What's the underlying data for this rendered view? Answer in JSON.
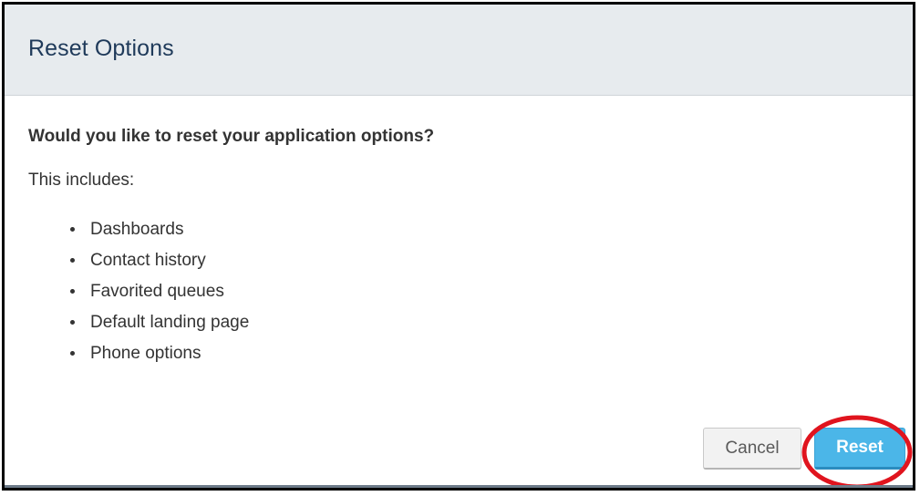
{
  "dialog": {
    "title": "Reset Options",
    "question": "Would you like to reset your application options?",
    "includes_label": "This includes:",
    "items": [
      {
        "label": "Dashboards"
      },
      {
        "label": "Contact history"
      },
      {
        "label": "Favorited queues"
      },
      {
        "label": "Default landing page"
      },
      {
        "label": "Phone options"
      }
    ],
    "buttons": {
      "cancel_label": "Cancel",
      "reset_label": "Reset"
    }
  },
  "colors": {
    "header_bg": "#e7ebee",
    "title_color": "#1f3a5a",
    "reset_button": "#4bb6e8",
    "annotation_ring": "#e0141e"
  }
}
